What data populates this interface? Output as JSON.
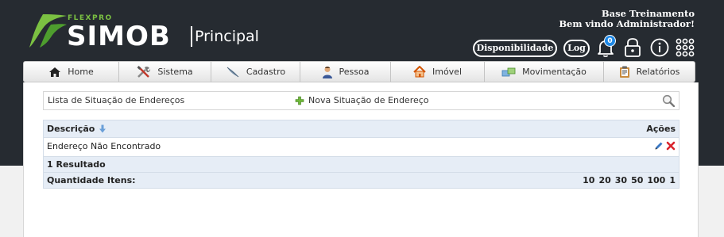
{
  "brand": {
    "tagline": "FLEXPRO",
    "name": "SIMOB",
    "module": "Principal"
  },
  "user": {
    "line1": "Base Treinamento",
    "line2": "Bem vindo Administrador!"
  },
  "topbar": {
    "availability_label": "Disponibilidade",
    "log_label": "Log",
    "notifications_count": "0"
  },
  "nav": {
    "items": [
      {
        "label": "Home",
        "icon": "home-icon"
      },
      {
        "label": "Sistema",
        "icon": "tools-icon"
      },
      {
        "label": "Cadastro",
        "icon": "feather-icon"
      },
      {
        "label": "Pessoa",
        "icon": "person-icon"
      },
      {
        "label": "Imóvel",
        "icon": "house-icon"
      },
      {
        "label": "Movimentação",
        "icon": "transfer-icon"
      },
      {
        "label": "Relatórios",
        "icon": "clipboard-icon"
      }
    ]
  },
  "toolbar": {
    "title": "Lista de Situação de Endereços",
    "new_label": "Nova Situação de Endereço"
  },
  "table": {
    "col_description": "Descrição",
    "col_actions": "Ações",
    "rows": [
      {
        "description": "Endereço Não Encontrado"
      }
    ],
    "result_count": "1 Resultado",
    "quantity_label": "Quantidade Itens:",
    "page_sizes": [
      "10",
      "20",
      "30",
      "50",
      "100",
      "1"
    ]
  },
  "colors": {
    "header_bg": "#262b31",
    "brand_green": "#7bc142",
    "grid_header_bg": "#e6edf6",
    "badge_blue": "#1e88e5",
    "delete_red": "#d9232d"
  }
}
